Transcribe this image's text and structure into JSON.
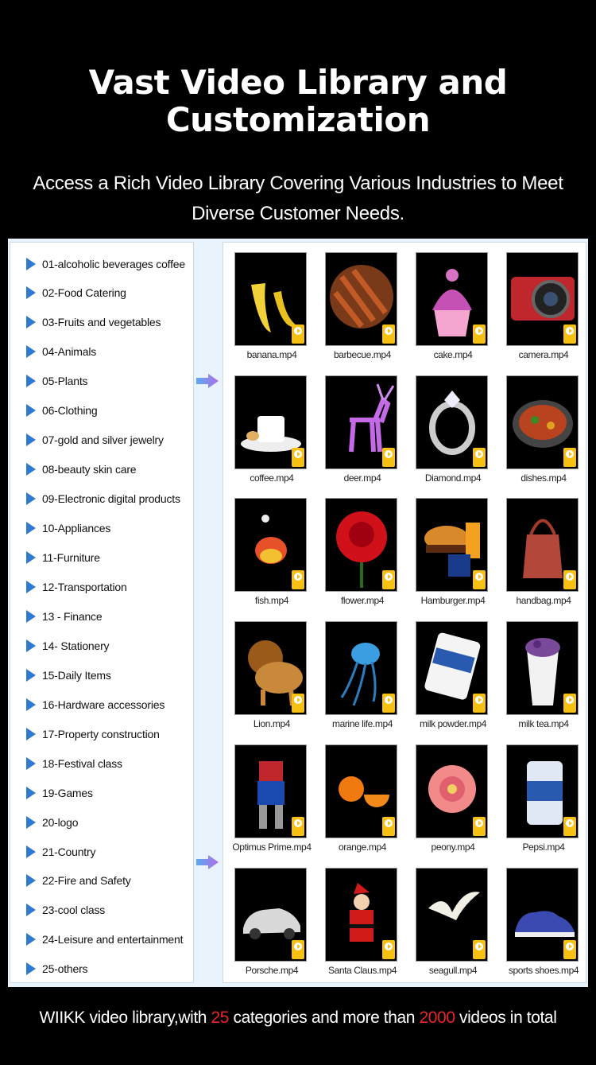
{
  "header": {
    "title_line1": "Vast Video Library and",
    "title_line2": "Customization",
    "subtitle_line1": "Access a Rich Video Library Covering Various Industries to Meet",
    "subtitle_line2": "Diverse Customer Needs."
  },
  "categories": [
    "01-alcoholic beverages coffee",
    "02-Food Catering",
    "03-Fruits and vegetables",
    "04-Animals",
    "05-Plants",
    "06-Clothing",
    "07-gold and silver jewelry",
    "08-beauty skin care",
    "09-Electronic digital products",
    "10-Appliances",
    "11-Furniture",
    "12-Transportation",
    "13 - Finance",
    "14- Stationery",
    "15-Daily Items",
    "16-Hardware accessories",
    "17-Property construction",
    "18-Festival class",
    "19-Games",
    "20-logo",
    "21-Country",
    "22-Fire and Safety",
    "23-cool class",
    "24-Leisure and entertainment",
    "25-others"
  ],
  "files": [
    {
      "name": "banana.mp4",
      "icon": "banana"
    },
    {
      "name": "barbecue.mp4",
      "icon": "barbecue"
    },
    {
      "name": "cake.mp4",
      "icon": "cupcake"
    },
    {
      "name": "camera.mp4",
      "icon": "camera"
    },
    {
      "name": "coffee.mp4",
      "icon": "coffee-cup"
    },
    {
      "name": "deer.mp4",
      "icon": "deer"
    },
    {
      "name": "Diamond.mp4",
      "icon": "diamond-ring"
    },
    {
      "name": "dishes.mp4",
      "icon": "dish"
    },
    {
      "name": "fish.mp4",
      "icon": "fish"
    },
    {
      "name": "flower.mp4",
      "icon": "rose"
    },
    {
      "name": "Hamburger.mp4",
      "icon": "hamburger"
    },
    {
      "name": "handbag.mp4",
      "icon": "handbag"
    },
    {
      "name": "Lion.mp4",
      "icon": "lion"
    },
    {
      "name": "marine life.mp4",
      "icon": "jellyfish"
    },
    {
      "name": "milk powder.mp4",
      "icon": "milk-powder"
    },
    {
      "name": "milk tea.mp4",
      "icon": "milk-tea"
    },
    {
      "name": "Optimus Prime.mp4",
      "icon": "robot"
    },
    {
      "name": "orange.mp4",
      "icon": "orange"
    },
    {
      "name": "peony.mp4",
      "icon": "peony"
    },
    {
      "name": "Pepsi.mp4",
      "icon": "can"
    },
    {
      "name": "Porsche.mp4",
      "icon": "car"
    },
    {
      "name": "Santa Claus.mp4",
      "icon": "santa"
    },
    {
      "name": "seagull.mp4",
      "icon": "seagull"
    },
    {
      "name": "sports shoes.mp4",
      "icon": "shoe"
    }
  ],
  "badge_label": "Player",
  "footer": {
    "part1": "WIIKK video library,with ",
    "categories_count": "25",
    "part2": " categories and more than ",
    "videos_count": "2000",
    "part3": " videos in total"
  },
  "colors": {
    "background": "#000000",
    "panel": "#e9f3fc",
    "category_triangle": "#2e7ad1",
    "highlight": "#e8262a",
    "badge": "#f6c112"
  }
}
